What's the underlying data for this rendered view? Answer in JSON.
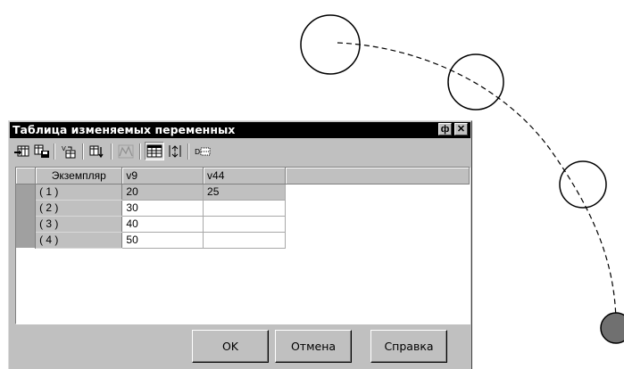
{
  "window": {
    "title": "Таблица изменяемых переменных",
    "pin_glyph": "ф",
    "close_glyph": "✕"
  },
  "toolbar": {
    "icons": [
      "open-table-icon",
      "save-table-icon",
      "insert-variable-icon",
      "sort-variables-icon",
      "graph-icon",
      "table-view-icon",
      "arrange-icon",
      "variable-order-icon"
    ]
  },
  "table": {
    "columns": [
      "Экземпляр",
      "v9",
      "v44",
      ""
    ],
    "rows": [
      {
        "instance": "( 1 )",
        "v9": "20",
        "v44": "25"
      },
      {
        "instance": "( 2 )",
        "v9": "30",
        "v44": ""
      },
      {
        "instance": "( 3 )",
        "v9": "40",
        "v44": ""
      },
      {
        "instance": "( 4 )",
        "v9": "50",
        "v44": ""
      }
    ]
  },
  "buttons": {
    "ok": "OK",
    "cancel": "Отмена",
    "help": "Справка"
  }
}
